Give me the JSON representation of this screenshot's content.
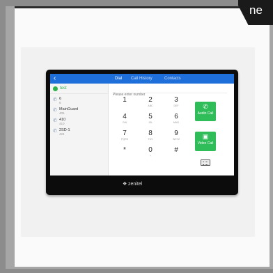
{
  "corner_tag": "ne",
  "device": {
    "topbar": {
      "back_icon": "chevron-left-icon",
      "tabs": [
        {
          "label": "Dial",
          "active": true
        },
        {
          "label": "Call History",
          "active": false
        },
        {
          "label": "Contacts",
          "active": false
        }
      ]
    },
    "sidebar": {
      "current": "test",
      "items": [
        {
          "title": "6",
          "sub": "6"
        },
        {
          "title": "MainGuard",
          "sub": "405"
        },
        {
          "title": "410",
          "sub": "410"
        },
        {
          "title": "2SD-1",
          "sub": "424"
        }
      ]
    },
    "dial_input": {
      "placeholder": "Please enter number"
    },
    "keypad": [
      {
        "num": "1",
        "sub": ""
      },
      {
        "num": "2",
        "sub": "abc"
      },
      {
        "num": "3",
        "sub": "def"
      },
      {
        "num": "4",
        "sub": "ghi"
      },
      {
        "num": "5",
        "sub": "jkl"
      },
      {
        "num": "6",
        "sub": "mno"
      },
      {
        "num": "7",
        "sub": "pqrs"
      },
      {
        "num": "8",
        "sub": "tuv"
      },
      {
        "num": "9",
        "sub": "wxyz"
      },
      {
        "num": "*",
        "sub": ""
      },
      {
        "num": "0",
        "sub": "+"
      },
      {
        "num": "#",
        "sub": ""
      }
    ],
    "buttons": {
      "audio_call": "Audio Call",
      "video_call": "Video Call"
    },
    "brand": "zenitel",
    "colors": {
      "accent_blue": "#1f6fdb",
      "call_green": "#2fbd59"
    }
  }
}
